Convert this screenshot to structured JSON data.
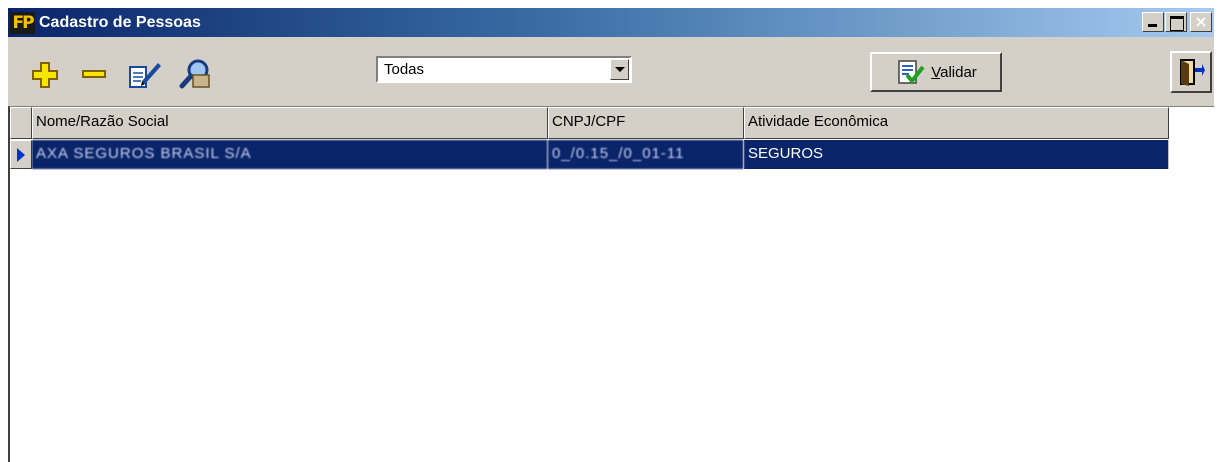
{
  "window": {
    "title": "Cadastro de Pessoas",
    "app_icon_text": "FP",
    "controls": [
      "minimize",
      "maximize",
      "close"
    ]
  },
  "toolbar": {
    "add_icon": "plus-icon",
    "remove_icon": "minus-icon",
    "edit_icon": "edit-pencil-icon",
    "search_icon": "magnifier-icon",
    "filter_selected": "Todas",
    "validar_prefix": "V",
    "validar_rest": "alidar",
    "exit_icon": "door-exit-icon"
  },
  "grid": {
    "columns": [
      "Nome/Razão Social",
      "CNPJ/CPF",
      "Atividade Econômica"
    ],
    "rows": [
      {
        "nome": "AXA SEGUROS BRASIL S/A",
        "cnpj": "0_/0.15_/0_01-11",
        "atividade": "SEGUROS",
        "selected": true
      }
    ]
  },
  "colors": {
    "title_gradient_start": "#0a246a",
    "title_gradient_end": "#a6caf0",
    "selection": "#0a246a",
    "face": "#d4d0c8"
  }
}
